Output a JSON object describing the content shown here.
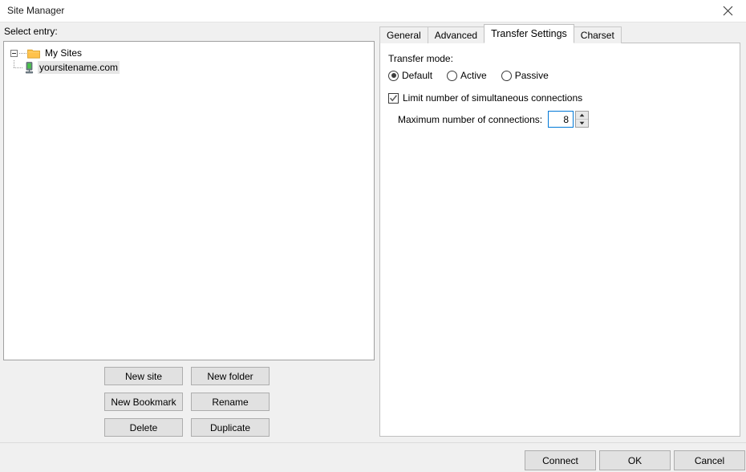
{
  "window": {
    "title": "Site Manager",
    "close_icon": "close-icon"
  },
  "left_pane": {
    "label": "Select entry:",
    "tree": {
      "root": {
        "label": "My Sites",
        "icon": "folder-icon",
        "expanded": true
      },
      "children": [
        {
          "label": "yoursitename.com",
          "icon": "server-icon",
          "selected": true
        }
      ]
    },
    "buttons": [
      {
        "label": "New site"
      },
      {
        "label": "New folder"
      },
      {
        "label": "New Bookmark"
      },
      {
        "label": "Rename"
      },
      {
        "label": "Delete"
      },
      {
        "label": "Duplicate"
      }
    ]
  },
  "right_pane": {
    "tabs": [
      {
        "label": "General",
        "active": false
      },
      {
        "label": "Advanced",
        "active": false
      },
      {
        "label": "Transfer Settings",
        "active": true
      },
      {
        "label": "Charset",
        "active": false
      }
    ],
    "transfer_settings": {
      "transfer_mode_label": "Transfer mode:",
      "transfer_mode_options": [
        {
          "label": "Default",
          "checked": true
        },
        {
          "label": "Active",
          "checked": false
        },
        {
          "label": "Passive",
          "checked": false
        }
      ],
      "limit_connections": {
        "label": "Limit number of simultaneous connections",
        "checked": true
      },
      "max_connections": {
        "label": "Maximum number of connections:",
        "value": "8"
      }
    }
  },
  "footer": {
    "connect_label": "Connect",
    "ok_label": "OK",
    "cancel_label": "Cancel"
  },
  "colors": {
    "dialog_bg": "#f0f0f0",
    "field_bg": "#ffffff",
    "focus_border": "#0078d7",
    "folder_icon": "#ffc24b",
    "selection": "#e6e6e6"
  }
}
